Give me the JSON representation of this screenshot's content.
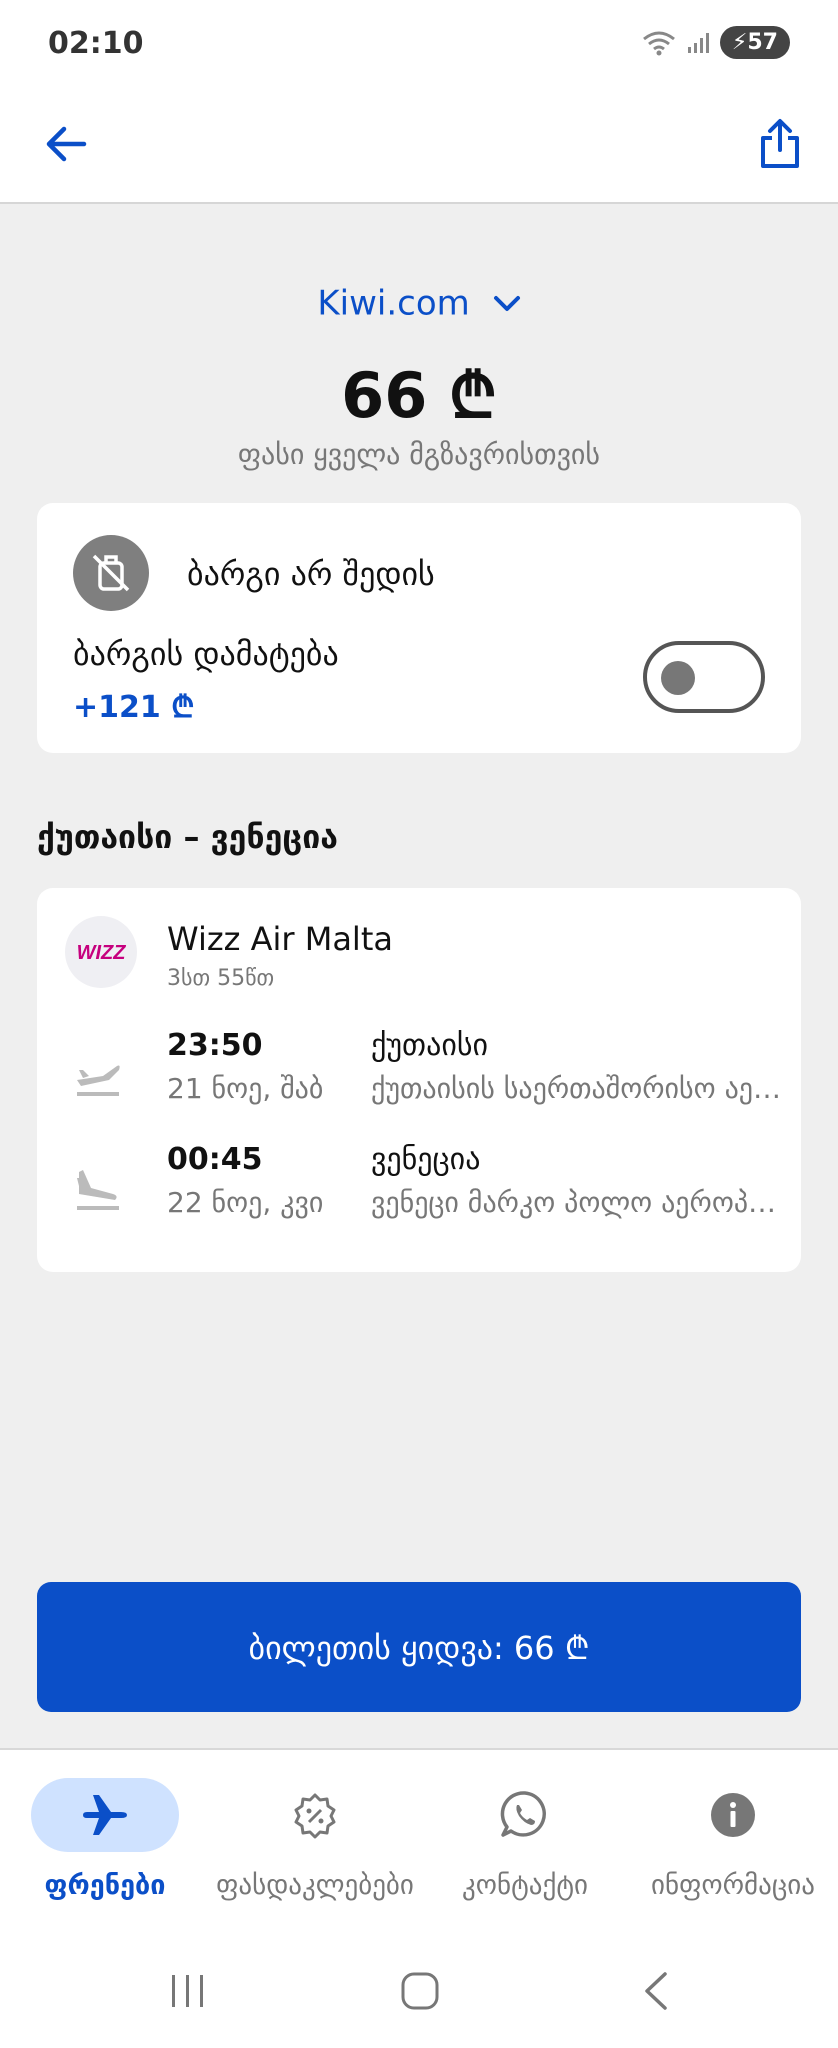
{
  "status": {
    "time": "02:10",
    "battery": "57"
  },
  "header": {
    "provider": "Kiwi.com",
    "price": "66 ₾",
    "price_note": "ფასი ყველა მგზავრისთვის"
  },
  "baggage": {
    "not_included": "ბარგი არ შედის",
    "add_label": "ბარგის დამატება",
    "add_price": "+121 ₾",
    "toggle_on": false
  },
  "route": {
    "title": "ქუთაისი – ვენეცია",
    "airline": "Wizz Air Malta",
    "logo_text": "WIZZ",
    "duration": "3სთ 55წთ",
    "segments": [
      {
        "time": "23:50",
        "date": "21 ნოე, შაბ",
        "city": "ქუთაისი",
        "airport": "ქუთაისის საერთაშორისო აეროპორტი"
      },
      {
        "time": "00:45",
        "date": "22 ნოე, კვი",
        "city": "ვენეცია",
        "airport": "ვენეცი მარკო პოლო აეროპორტი"
      }
    ]
  },
  "buy_button": "ბილეთის ყიდვა: 66 ₾",
  "nav": [
    {
      "label": "ფრენები",
      "icon": "airplane-icon",
      "active": true
    },
    {
      "label": "ფასდაკლებები",
      "icon": "discount-icon",
      "active": false
    },
    {
      "label": "კონტაქტი",
      "icon": "whatsapp-icon",
      "active": false
    },
    {
      "label": "ინფორმაცია",
      "icon": "info-icon",
      "active": false
    }
  ],
  "colors": {
    "accent": "#0b4fc8",
    "background": "#efefef",
    "nav_active_bg": "#cfe2ff"
  }
}
